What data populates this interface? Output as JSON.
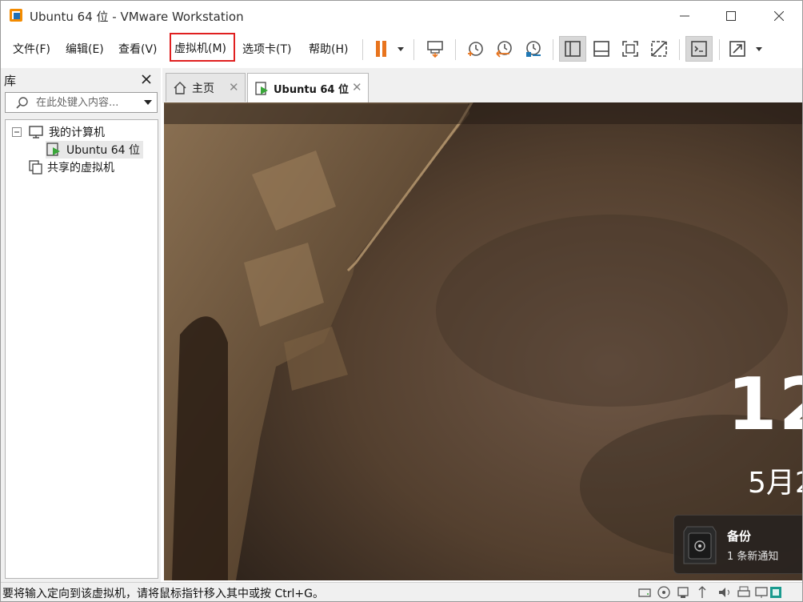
{
  "window": {
    "title": "Ubuntu 64 位 - VMware Workstation"
  },
  "menu": {
    "file": "文件(F)",
    "edit": "编辑(E)",
    "view": "查看(V)",
    "vm": "虚拟机(M)",
    "tabs": "选项卡(T)",
    "help": "帮助(H)"
  },
  "library": {
    "title": "库",
    "search_placeholder": "在此处键入内容...",
    "tree": {
      "my_computer": "我的计算机",
      "vm_item": "Ubuntu 64 位",
      "shared_vms": "共享的虚拟机"
    }
  },
  "tabs": {
    "home": "主页",
    "vm": "Ubuntu 64 位"
  },
  "vm_screen": {
    "time_partial": "12",
    "date_partial": "5月2",
    "notification": {
      "title": "备份",
      "body": "1 条新通知"
    }
  },
  "status": {
    "message": "要将输入定向到该虚拟机，请将鼠标指针移入其中或按 Ctrl+G。"
  },
  "colors": {
    "highlight_border": "#e02020",
    "pause_orange": "#e8741e",
    "vm_play_green": "#3aa63a"
  }
}
